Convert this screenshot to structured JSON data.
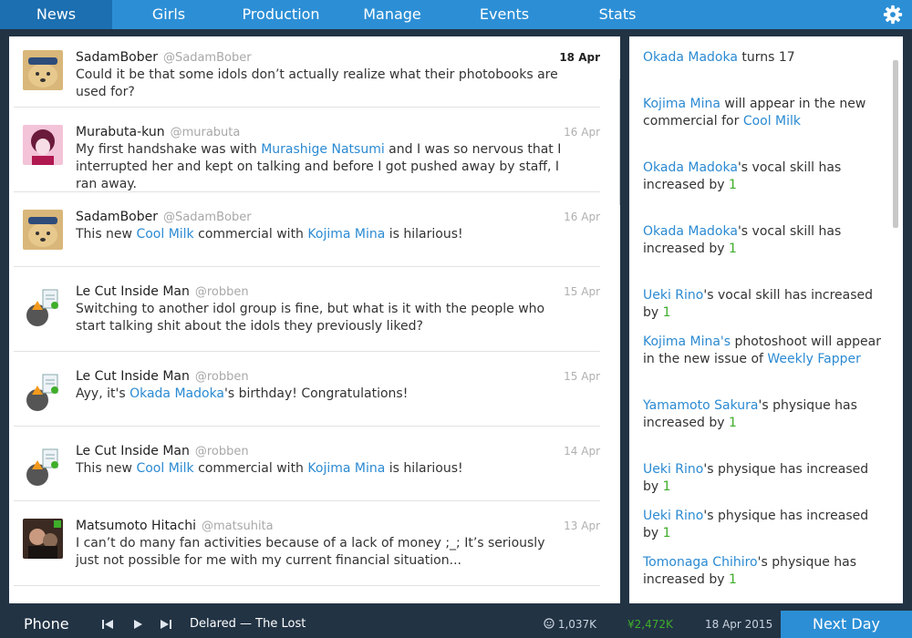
{
  "nav": {
    "tabs": [
      "News",
      "Girls",
      "Production",
      "Manage",
      "Events",
      "Stats"
    ],
    "active": "News",
    "settings_icon": "gear-icon"
  },
  "feed": {
    "posts": [
      {
        "name": "SadamBober",
        "handle": "@SadamBober",
        "date": "18 Apr",
        "date_bold": true,
        "avatar": "doge-avatar",
        "parts": [
          "Could it be that some idols don’t actually realize what their photobooks are used for?"
        ]
      },
      {
        "name": "Murabuta-kun",
        "handle": "@murabuta",
        "date": "16 Apr",
        "avatar": "anime-avatar",
        "parts": [
          "My first handshake was with ",
          "Murashige Natsumi",
          " and I was so nervous that I interrupted her and kept on talking and before I got pushed away by staff, I ran away."
        ]
      },
      {
        "name": "SadamBober",
        "handle": "@SadamBober",
        "date": "16 Apr",
        "avatar": "doge-avatar",
        "parts": [
          "This new ",
          "Cool Milk",
          " commercial with ",
          "Kojima Mina",
          " is hilarious!"
        ]
      },
      {
        "name": "Le Cut Inside Man",
        "handle": "@robben",
        "date": "15 Apr",
        "avatar": "robben-avatar",
        "parts": [
          "Switching to another idol group is fine, but what is it with the people who start talking shit about the idols they previously liked?"
        ]
      },
      {
        "name": "Le Cut Inside Man",
        "handle": "@robben",
        "date": "15 Apr",
        "avatar": "robben-avatar",
        "parts": [
          "Ayy, it's ",
          "Okada Madoka",
          "'s birthday! Congratulations!"
        ]
      },
      {
        "name": "Le Cut Inside Man",
        "handle": "@robben",
        "date": "14 Apr",
        "avatar": "robben-avatar",
        "parts": [
          "This new ",
          "Cool Milk",
          " commercial with ",
          "Kojima Mina",
          " is hilarious!"
        ]
      },
      {
        "name": "Matsumoto Hitachi",
        "handle": "@matsuhita",
        "date": "13 Apr",
        "avatar": "photo-avatar",
        "parts": [
          "I can’t do many fan activities because of a lack of money ;_; It’s seriously just not possible for me with my current financial situation..."
        ]
      }
    ]
  },
  "events": {
    "items": [
      {
        "parts": [
          "Okada Madoka",
          " turns 17"
        ]
      },
      {
        "parts": [
          "Kojima Mina",
          " will appear in the new commercial for ",
          "Cool Milk"
        ]
      },
      {
        "parts": [
          "Okada Madoka",
          "'s vocal skill has increased by ",
          "1"
        ]
      },
      {
        "parts": [
          "Okada Madoka",
          "'s vocal skill has increased by ",
          "1"
        ]
      },
      {
        "parts": [
          "Ueki Rino",
          "'s vocal skill has increased by ",
          "1"
        ]
      },
      {
        "parts": [
          "Kojima Mina's",
          " photoshoot will appear in the new issue of ",
          "Weekly Fapper"
        ]
      },
      {
        "parts": [
          "Yamamoto Sakura",
          "'s physique has increased by ",
          "1"
        ]
      },
      {
        "parts": [
          "Ueki Rino",
          "'s physique has increased by ",
          "1"
        ]
      },
      {
        "parts": [
          "Ueki Rino",
          "'s physique has increased by ",
          "1"
        ]
      },
      {
        "parts": [
          "Tomonaga Chihiro",
          "'s physique has increased by ",
          "1"
        ]
      }
    ]
  },
  "bottom": {
    "phone_label": "Phone",
    "track": "Delared — The Lost",
    "fans": "1,037K",
    "money": "¥2,472K",
    "date": "18 Apr 2015",
    "next_day_label": "Next Day"
  },
  "colors": {
    "accent": "#2c8fd6",
    "link": "#2b8ad2",
    "positive": "#3fae2a",
    "background": "#223344"
  }
}
